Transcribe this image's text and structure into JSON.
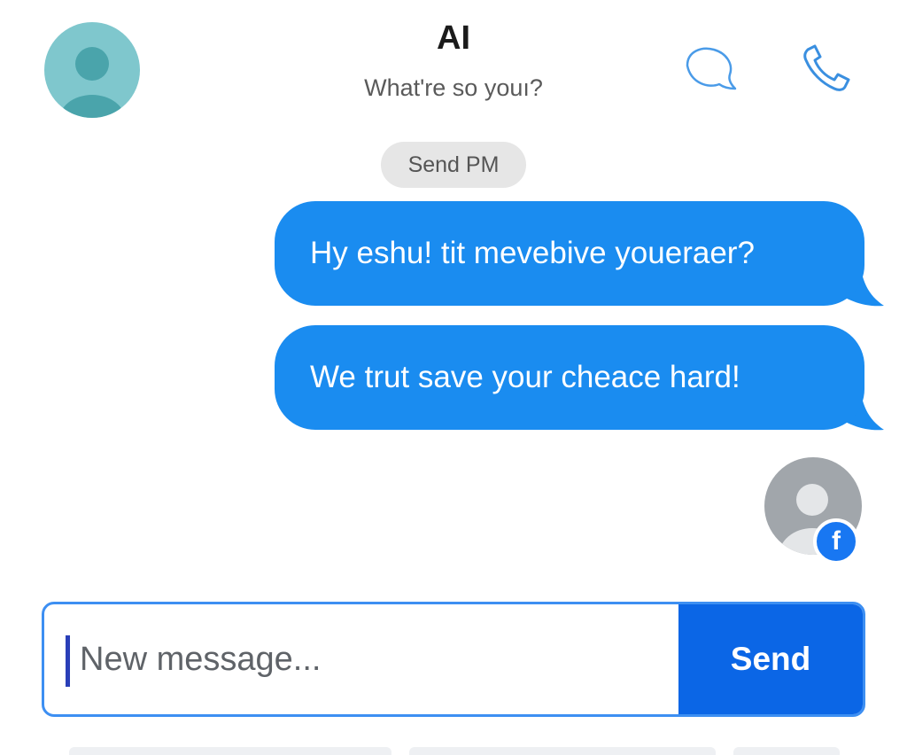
{
  "header": {
    "title": "AI",
    "subtitle": "What're so youı?",
    "avatar_icon": "person-icon",
    "chat_icon": "chat-bubble-icon",
    "call_icon": "phone-icon",
    "accent_color": "#3d8ff2"
  },
  "timestamp_pill": "Send PM",
  "messages": [
    {
      "text": "Hy eshu! tit mevebive youeraer?",
      "direction": "outgoing"
    },
    {
      "text": "We trut save your cheace hard!",
      "direction": "outgoing"
    }
  ],
  "contact": {
    "avatar_icon": "person-icon",
    "badge_icon": "facebook-icon",
    "badge_label": "f",
    "badge_color": "#1877f2"
  },
  "composer": {
    "placeholder": "New message...",
    "value": "",
    "send_label": "Send",
    "send_color": "#0b66e6"
  },
  "colors": {
    "bubble": "#1a8cf0",
    "pill_bg": "#e6e6e6",
    "header_avatar_bg": "#7fc7cd"
  }
}
